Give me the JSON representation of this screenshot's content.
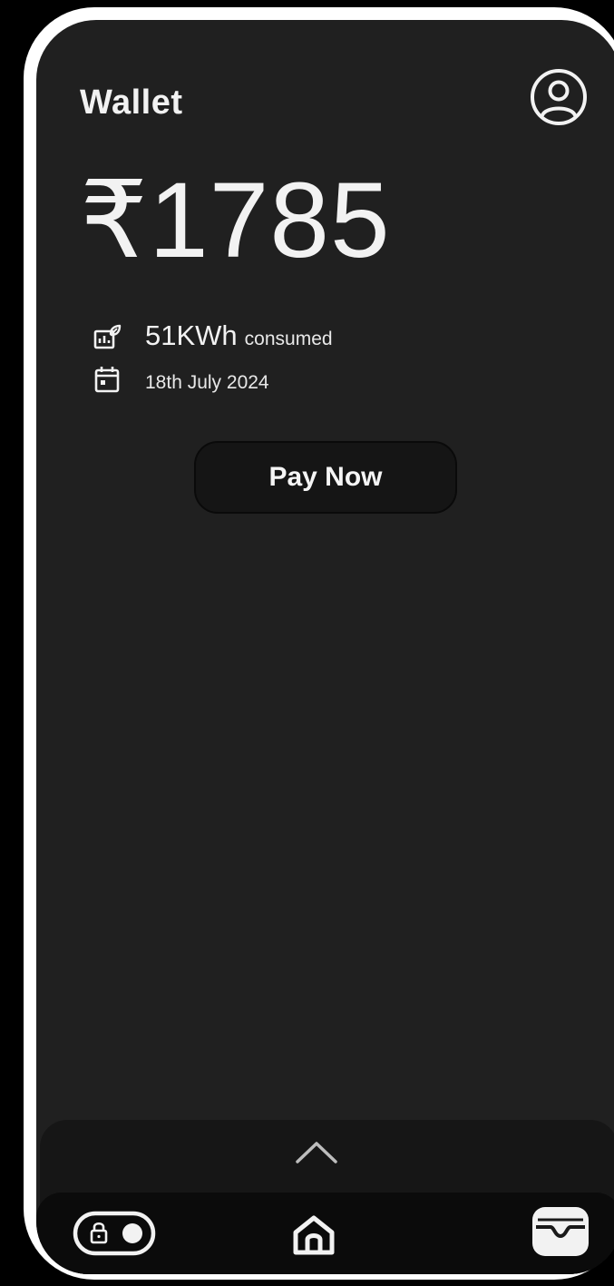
{
  "header": {
    "title": "Wallet",
    "profile_icon": "user-circle-icon"
  },
  "wallet": {
    "amount": "₹1785",
    "energy_value": "51KWh",
    "energy_label": "consumed",
    "energy_icon": "eco-energy-chart-icon",
    "date": "18th July 2024",
    "date_icon": "calendar-icon"
  },
  "actions": {
    "pay_now_label": "Pay Now"
  },
  "drawer": {
    "handle_icon": "chevron-up-icon"
  },
  "navbar": {
    "items": [
      {
        "icon": "lock-toggle-icon"
      },
      {
        "icon": "home-icon"
      },
      {
        "icon": "wallet-icon"
      }
    ]
  },
  "colors": {
    "background": "#000000",
    "frame": "#ffffff",
    "screen": "#202020",
    "text": "#f2f2f2",
    "button": "#151515",
    "navbar": "#0b0b0b"
  }
}
